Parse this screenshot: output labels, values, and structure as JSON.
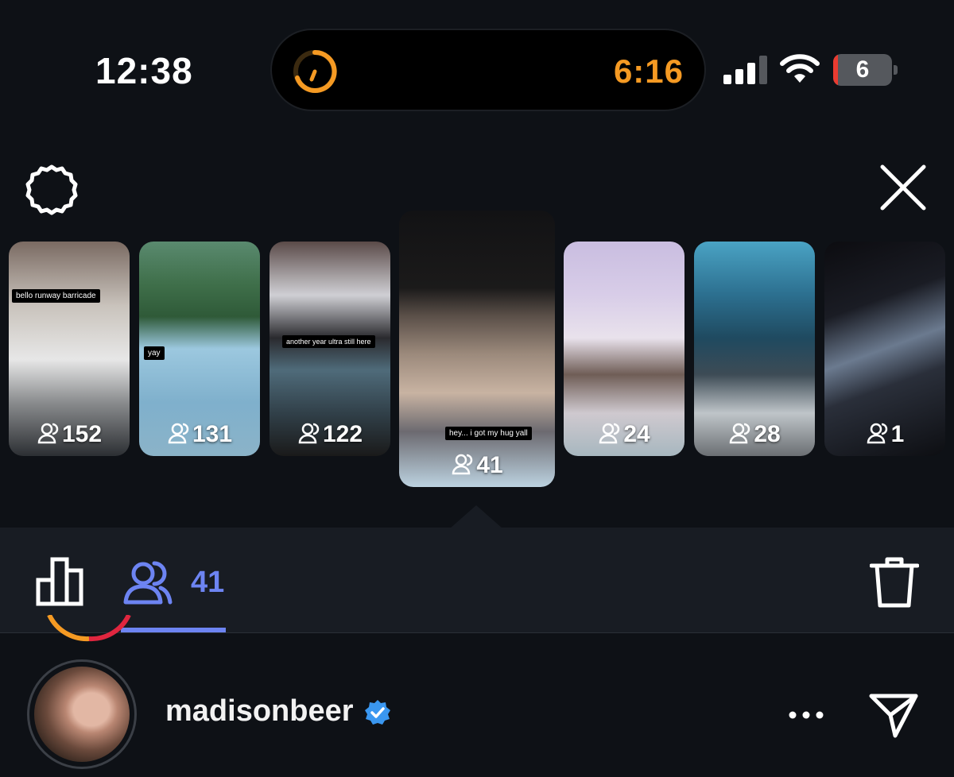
{
  "status_bar": {
    "time": "12:38",
    "timer": "6:16",
    "timer_color": "#f59a23",
    "battery_level": "6",
    "battery_fill_fraction": 0.06
  },
  "stories": [
    {
      "views": "152",
      "caption": "bello runway barricade"
    },
    {
      "views": "131",
      "caption": "yay"
    },
    {
      "views": "122",
      "caption": "another year ultra still here"
    },
    {
      "views": "41",
      "caption": "hey... i got my hug yall",
      "selected": true
    },
    {
      "views": "24",
      "caption": ""
    },
    {
      "views": "28",
      "caption": ""
    },
    {
      "views": "1",
      "caption": ""
    }
  ],
  "toolbar": {
    "viewers_count": "41",
    "accent_color": "#6d84f2"
  },
  "profile": {
    "username": "madisonbeer",
    "verified": true
  },
  "icons": [
    "settings-icon",
    "close-icon",
    "insights-icon",
    "viewers-icon",
    "trash-icon",
    "verified-icon",
    "more-icon",
    "share-icon"
  ]
}
